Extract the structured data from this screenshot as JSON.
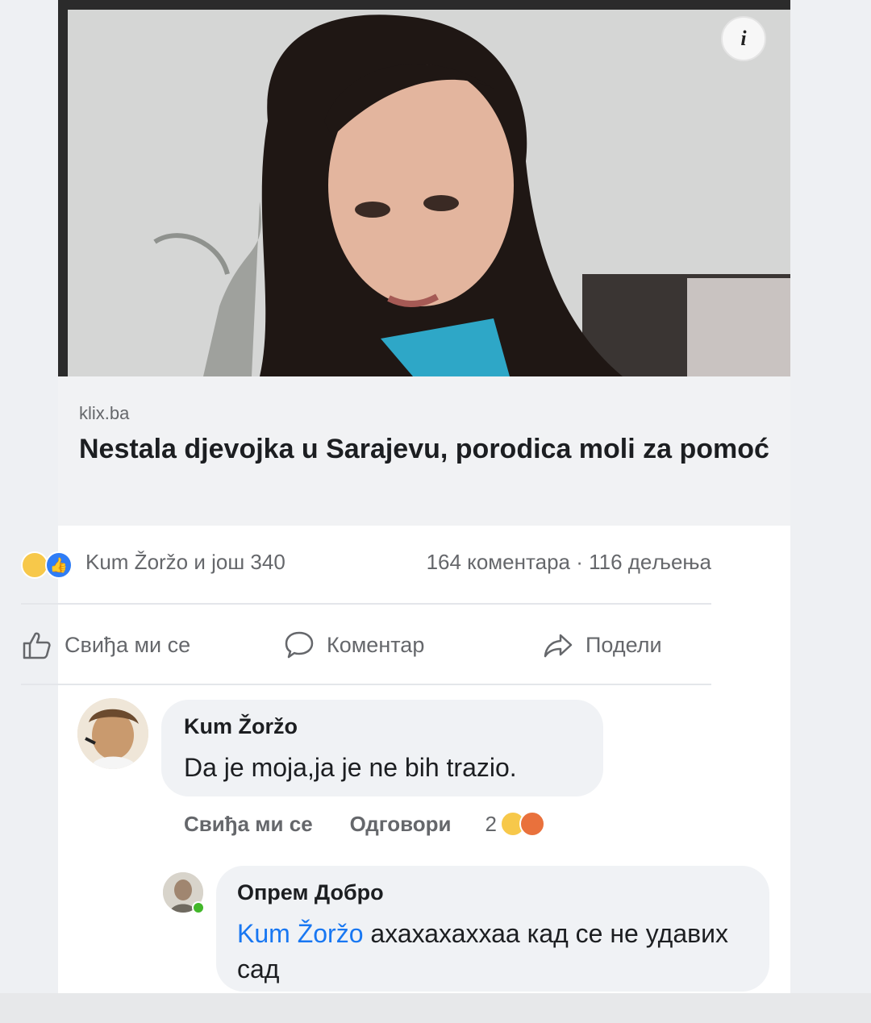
{
  "post": {
    "photo_alt": "",
    "info_icon": "i",
    "link": {
      "domain": "klix.ba",
      "headline": "Nestala djevojka u Sarajevu, porodica moli za pomoć"
    },
    "stats": {
      "reactions_text": "Kum Žoržo и још 340",
      "counts_text": "164 коментара · 116 дељења"
    },
    "actions": {
      "like": "Свиђа ми се",
      "comment": "Коментар",
      "share": "Подели"
    }
  },
  "comments": [
    {
      "author": "Kum Žoržo",
      "text": "Da je moja,ja je ne bih trazio.",
      "like_label": "Свиђа ми се",
      "reply_label": "Одговори",
      "reaction_count": "2"
    },
    {
      "author": "Опрем Добро",
      "mention": "Kum Žoržo",
      "text": " ахахахаххаа кад се не удавих сад"
    }
  ],
  "colors": {
    "accent": "#1877f2",
    "muted": "#65676b",
    "bubble": "#f0f2f5"
  }
}
